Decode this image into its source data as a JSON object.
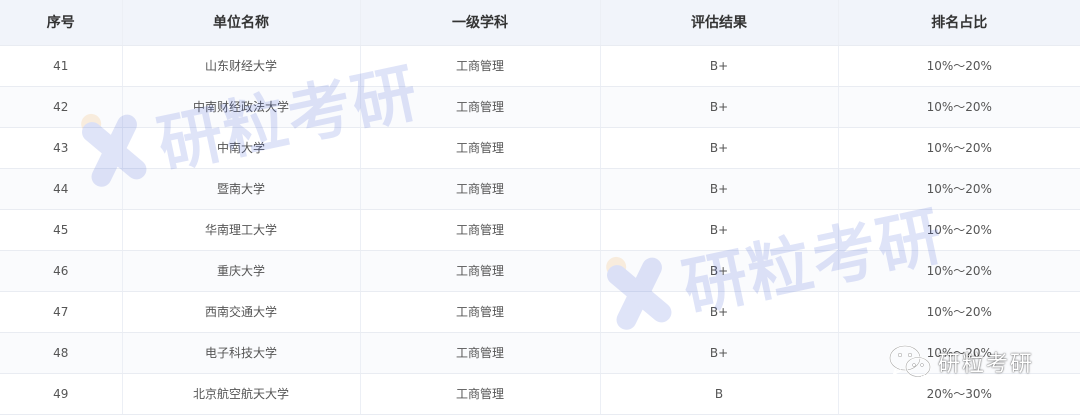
{
  "table": {
    "headers": [
      "序号",
      "单位名称",
      "一级学科",
      "评估结果",
      "排名占比"
    ],
    "rows": [
      [
        "41",
        "山东财经大学",
        "工商管理",
        "B+",
        "10%～20%"
      ],
      [
        "42",
        "中南财经政法大学",
        "工商管理",
        "B+",
        "10%～20%"
      ],
      [
        "43",
        "中南大学",
        "工商管理",
        "B+",
        "10%～20%"
      ],
      [
        "44",
        "暨南大学",
        "工商管理",
        "B+",
        "10%～20%"
      ],
      [
        "45",
        "华南理工大学",
        "工商管理",
        "B+",
        "10%～20%"
      ],
      [
        "46",
        "重庆大学",
        "工商管理",
        "B+",
        "10%～20%"
      ],
      [
        "47",
        "西南交通大学",
        "工商管理",
        "B+",
        "10%～20%"
      ],
      [
        "48",
        "电子科技大学",
        "工商管理",
        "B+",
        "10%～20%"
      ],
      [
        "49",
        "北京航空航天大学",
        "工商管理",
        "B",
        "20%～30%"
      ]
    ]
  },
  "watermark": {
    "text": "研粒考研",
    "icon": "x-logo-icon",
    "colors": {
      "primary": "#3e5bd6",
      "accent": "#f3a43a"
    }
  },
  "wechat_badge": {
    "icon": "wechat-icon",
    "label": "研粒考研"
  },
  "colors": {
    "header_bg": "#f1f4fa",
    "row_alt_bg": "#fafbfd",
    "border": "#e9ecf2"
  }
}
